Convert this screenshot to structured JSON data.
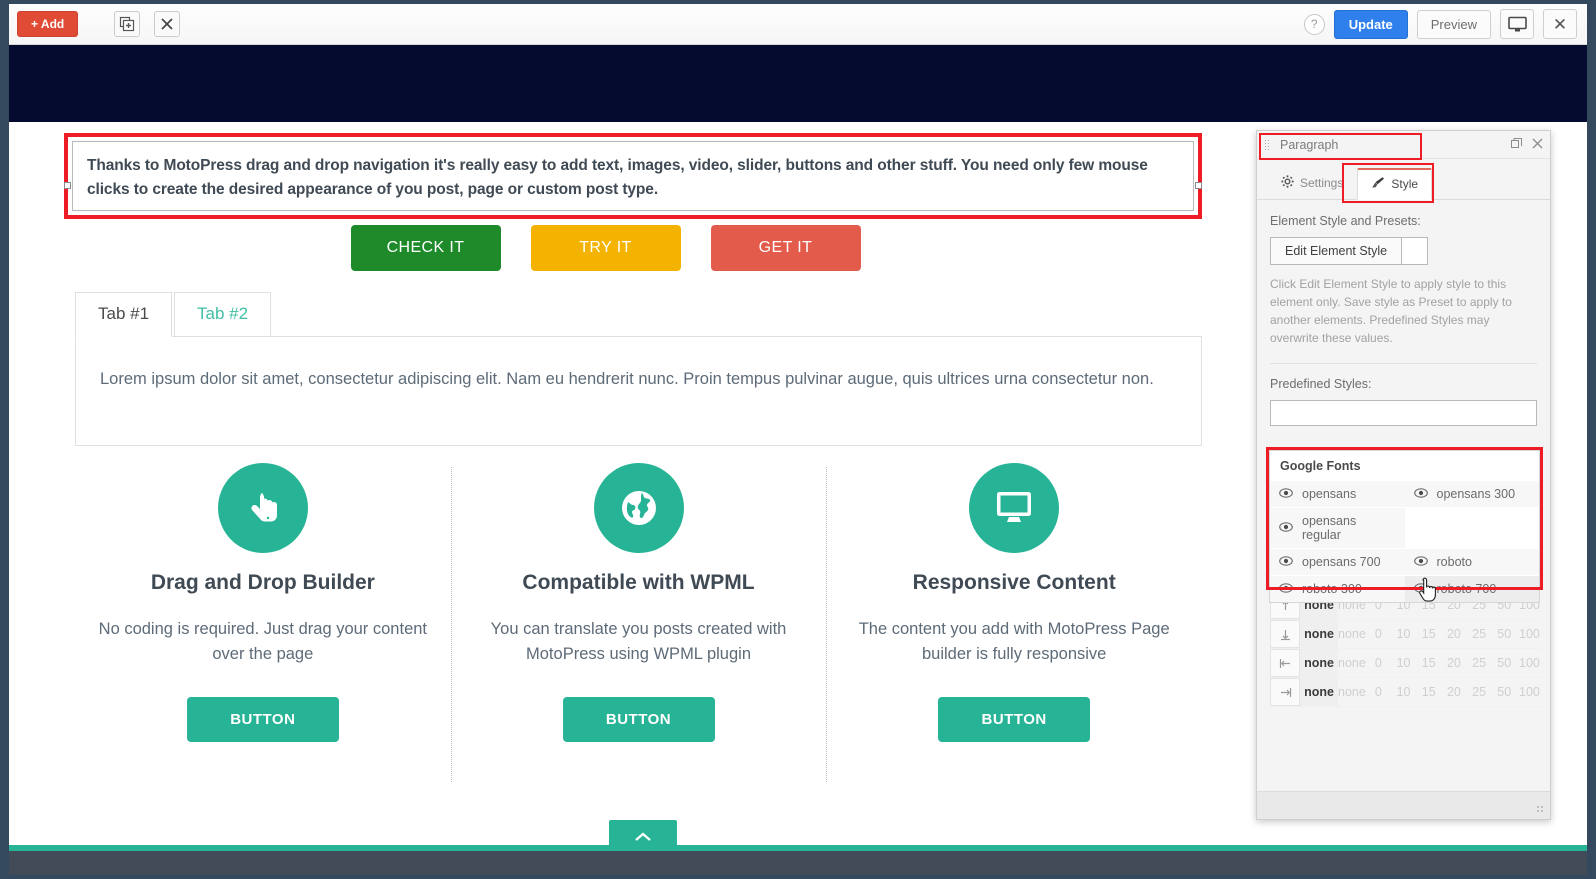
{
  "toolbar": {
    "add_label": "+ Add",
    "duplicate_icon": "duplicate-icon",
    "close_icon": "close-icon",
    "help_label": "?",
    "update_label": "Update",
    "preview_label": "Preview",
    "device_icon": "desktop-icon",
    "close_label": "✕"
  },
  "canvas": {
    "paragraph": {
      "text": "Thanks to MotoPress drag and drop navigation it's really easy to add text, images, video, slider, buttons and other stuff. You need only few mouse clicks to create the desired appearance of you post, page or custom post type."
    },
    "cta_buttons": [
      {
        "label": "CHECK IT",
        "color": "#1e8a2a"
      },
      {
        "label": "TRY IT",
        "color": "#f5b301"
      },
      {
        "label": "GET IT",
        "color": "#e35b4a"
      }
    ],
    "tabs": {
      "items": [
        {
          "label": "Tab #1",
          "active": true
        },
        {
          "label": "Tab #2",
          "active": false
        }
      ],
      "body": "Lorem ipsum dolor sit amet, consectetur adipiscing elit. Nam eu hendrerit nunc. Proin tempus pulvinar augue, quis ultrices urna consectetur non."
    },
    "features": [
      {
        "icon": "pointing-hand-icon",
        "title": "Drag and Drop Builder",
        "desc": "No coding is required. Just drag your content over the page",
        "button": "BUTTON"
      },
      {
        "icon": "globe-icon",
        "title": "Compatible with WPML",
        "desc": "You can translate you posts created with MotoPress using WPML plugin",
        "button": "BUTTON"
      },
      {
        "icon": "monitor-icon",
        "title": "Responsive Content",
        "desc": "The content you add with MotoPress Page builder is fully responsive",
        "button": "BUTTON"
      }
    ],
    "back_to_top_icon": "chevron-up-icon"
  },
  "panel": {
    "title": "Paragraph",
    "maximize_icon": "restore-icon",
    "close_icon": "close-icon",
    "tabs": [
      {
        "label": "Settings",
        "icon": "gear-icon",
        "active": false
      },
      {
        "label": "Style",
        "icon": "brush-icon",
        "active": true
      }
    ],
    "element_style_label": "Element Style and Presets:",
    "edit_element_style_button": "Edit Element Style",
    "hint": "Click Edit Element Style to apply style to this element only. Save style as Preset to apply to another elements. Predefined Styles may overwrite these values.",
    "predefined_styles_label": "Predefined Styles:",
    "combo_value": "",
    "combo_placeholder": "",
    "dropdown": {
      "group_label": "Google Fonts",
      "items": [
        {
          "label": "opensans",
          "icon": "eye-icon",
          "hover": false
        },
        {
          "label": "opensans 300",
          "icon": "eye-icon",
          "hover": false
        },
        {
          "label": "opensans regular",
          "icon": "eye-icon",
          "hover": false
        },
        {
          "label": "",
          "icon": "",
          "hover": false
        },
        {
          "label": "opensans 700",
          "icon": "eye-icon",
          "hover": false
        },
        {
          "label": "roboto",
          "icon": "eye-icon",
          "hover": false
        },
        {
          "label": "roboto 300",
          "icon": "eye-icon",
          "hover": false
        },
        {
          "label": "roboto 700",
          "icon": "eye-icon",
          "hover": true
        }
      ]
    },
    "spacing_rows": [
      {
        "icon": "margin-top-icon",
        "current": "none",
        "options": [
          "none",
          "0",
          "10",
          "15",
          "20",
          "25",
          "50",
          "100"
        ]
      },
      {
        "icon": "margin-bottom-icon",
        "current": "none",
        "options": [
          "none",
          "0",
          "10",
          "15",
          "20",
          "25",
          "50",
          "100"
        ]
      },
      {
        "icon": "margin-left-icon",
        "current": "none",
        "options": [
          "none",
          "0",
          "10",
          "15",
          "20",
          "25",
          "50",
          "100"
        ]
      },
      {
        "icon": "margin-right-icon",
        "current": "none",
        "options": [
          "none",
          "0",
          "10",
          "15",
          "20",
          "25",
          "50",
          "100"
        ]
      }
    ]
  },
  "colors": {
    "accent_teal": "#27b496",
    "primary_blue": "#2f80ed",
    "add_red": "#e04b36",
    "highlight_red": "#ee1c25",
    "hero_navy": "#040b2e",
    "chrome_dark": "#34495e"
  }
}
